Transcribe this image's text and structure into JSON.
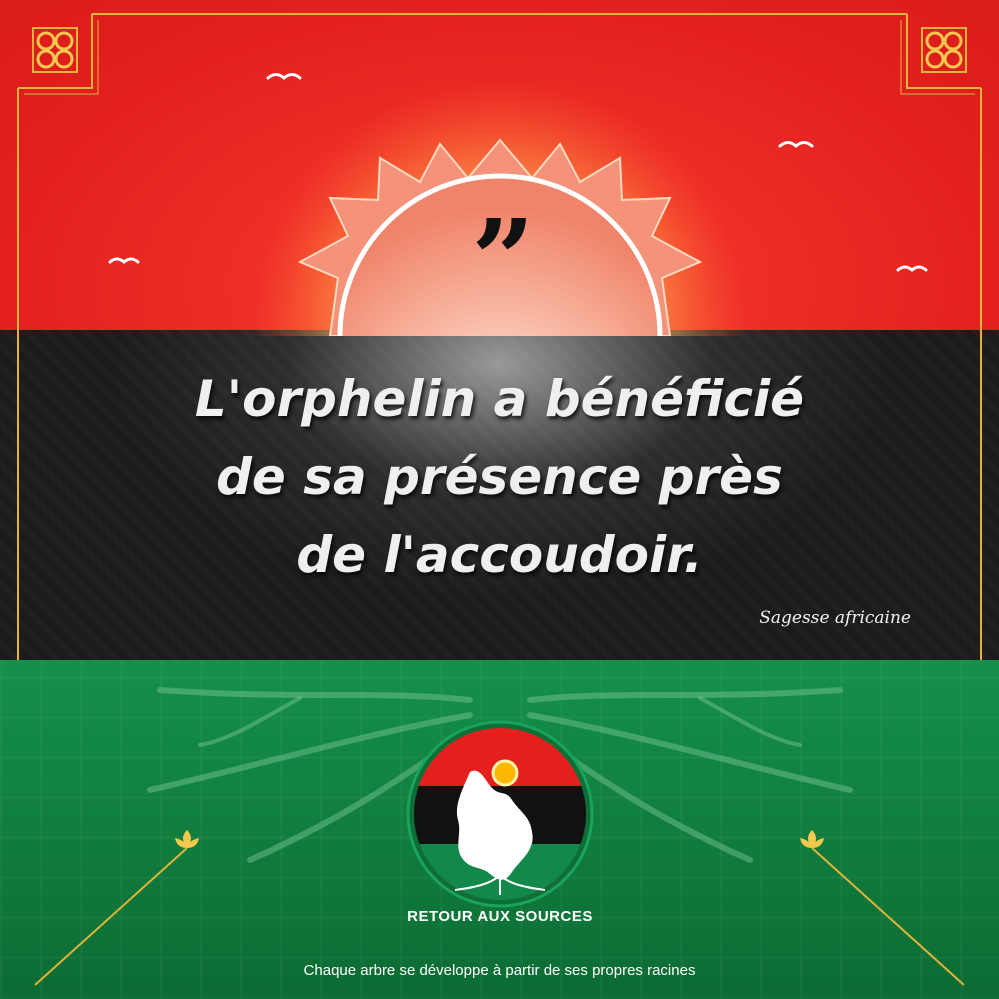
{
  "quote": {
    "mark": "”",
    "text": "L'orphelin a bénéficié\nde sa présence près\nde l'accoudoir."
  },
  "attribution": "Sagesse africaine",
  "logo": {
    "brand_name": "RETOUR AUX SOURCES"
  },
  "tagline": "Chaque arbre se développe à partir de ses propres racines",
  "colors": {
    "red": "#e3201e",
    "black": "#1b1b1b",
    "green": "#12884a",
    "gold": "#e0b43a",
    "sun": "#ffb54a"
  }
}
